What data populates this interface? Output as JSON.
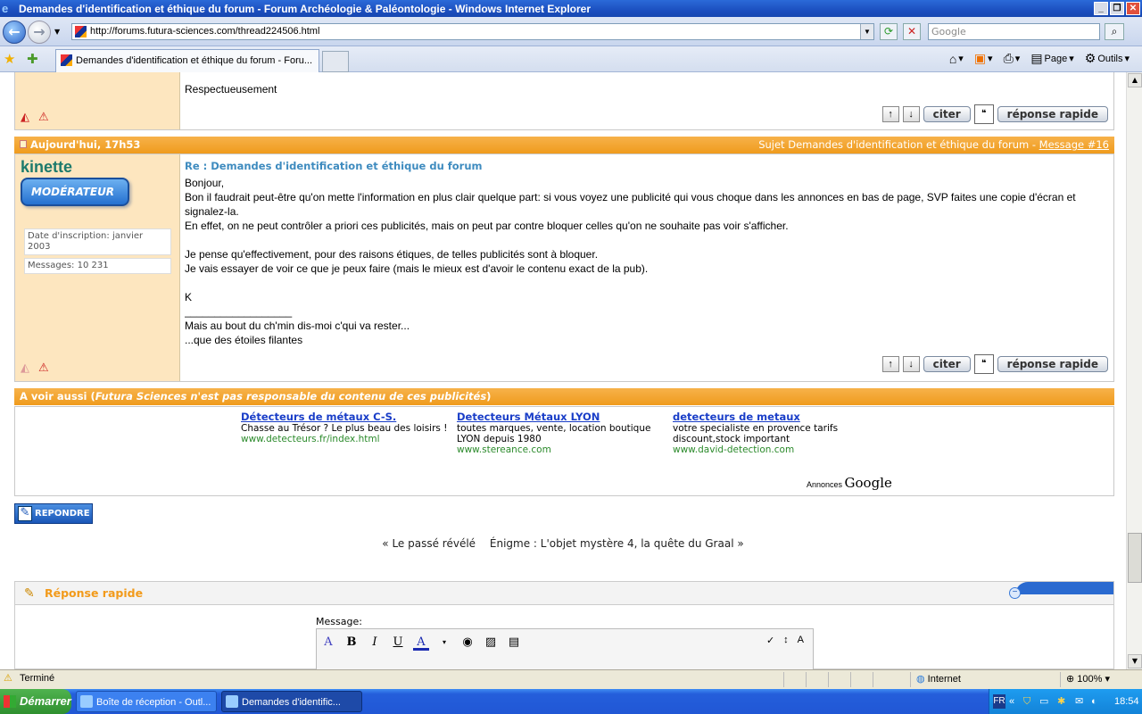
{
  "window": {
    "title": "Demandes d'identification et éthique du forum - Forum Archéologie & Paléontologie - Windows Internet Explorer",
    "min": "_",
    "max": "❐",
    "close": "✕"
  },
  "address": {
    "url": "http://forums.futura-sciences.com/thread224506.html",
    "search_placeholder": "Google"
  },
  "tabs": {
    "active": "Demandes d'identification et éthique du forum - Foru..."
  },
  "commands": {
    "page": "Page",
    "tools": "Outils"
  },
  "post15": {
    "text": "Respectueusement"
  },
  "post16": {
    "date": "Aujourd'hui, 17h53",
    "subject_prefix": "Sujet Demandes d'identification et éthique du forum -",
    "msg_link": "Message #16",
    "author": "kinette",
    "badge": "MODÉRATEUR",
    "joined": "Date d'inscription: janvier 2003",
    "messages": "Messages: 10 231",
    "title": "Re : Demandes d'identification et éthique du forum",
    "l1": "Bonjour,",
    "l2": "Bon il faudrait peut-être qu'on mette l'information en plus clair quelque part: si vous voyez une publicité qui vous choque dans les annonces en bas de page, SVP faites une copie d'écran et signalez-la.",
    "l3": "En effet, on ne peut contrôler a priori ces publicités, mais on peut par contre bloquer celles qu'on ne souhaite pas voir s'afficher.",
    "l4": "Je pense qu'effectivement, pour des raisons étiques, de telles publicités sont à bloquer.",
    "l5": "Je vais essayer de voir ce que je peux faire (mais le mieux est d'avoir le contenu exact de la pub).",
    "l6": "K",
    "sig_line": "__________________",
    "sig1": "Mais au bout du ch'min dis-moi c'qui va rester...",
    "sig2": "...que des étoiles filantes"
  },
  "buttons": {
    "cite": "citer",
    "quick": "réponse rapide",
    "up": "↑",
    "down": "↓",
    "reply": "REPONDRE"
  },
  "ads": {
    "header_pre": "A voir aussi (",
    "header_em": "Futura Sciences n'est pas responsable du contenu de ces publicités",
    "header_post": ")",
    "items": [
      {
        "title": "Détecteurs de métaux C-S.",
        "desc": "Chasse au Trésor ? Le plus beau des loisirs !",
        "url": "www.detecteurs.fr/index.html"
      },
      {
        "title": "Detecteurs Métaux LYON",
        "desc": "toutes marques, vente, location boutique LYON depuis 1980",
        "url": "www.stereance.com"
      },
      {
        "title": "detecteurs de metaux",
        "desc": "votre specialiste en provence tarifs discount,stock important",
        "url": "www.david-detection.com"
      }
    ],
    "annonces": "Annonces",
    "google": "Google"
  },
  "pager": {
    "prev": "« Le passé révélé",
    "next": "Énigme : L'objet mystère 4, la quête du Graal »"
  },
  "quick": {
    "title": "Réponse rapide",
    "message_label": "Message:"
  },
  "status": {
    "text": "Terminé",
    "zone": "Internet",
    "zoom": "100%"
  },
  "taskbar": {
    "start": "Démarrer",
    "task1": "Boîte de réception - Outl...",
    "task2": "Demandes d'identific...",
    "lang": "FR",
    "clock": "18:54"
  }
}
